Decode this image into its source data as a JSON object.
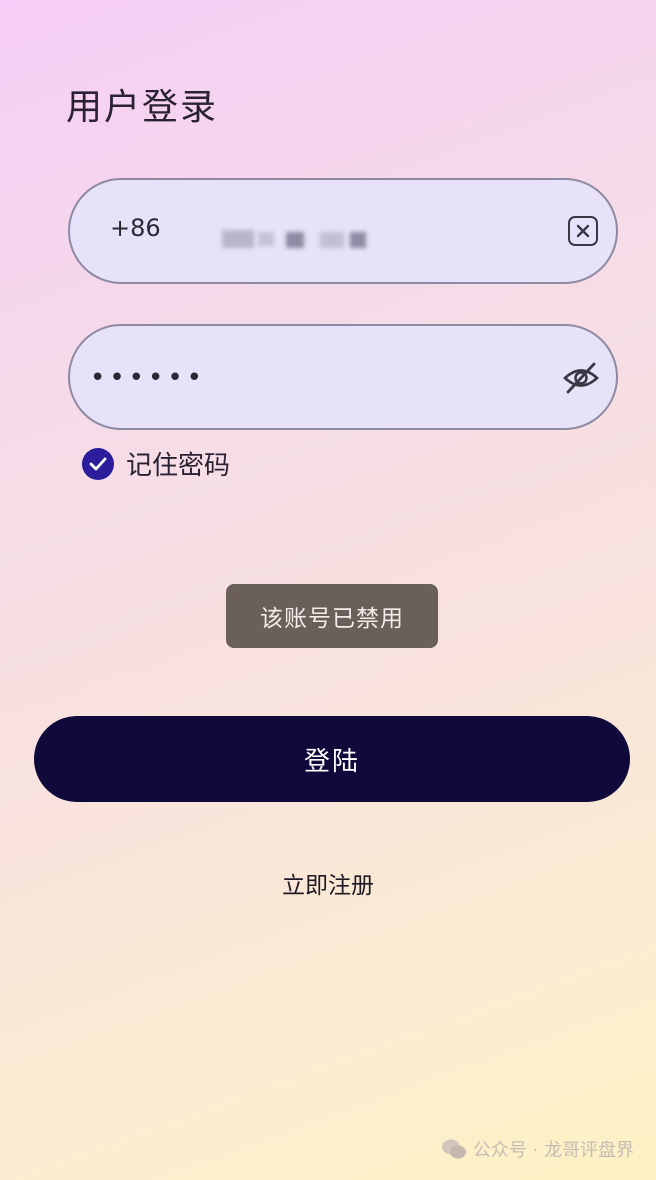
{
  "page": {
    "title": "用户登录"
  },
  "phone_field": {
    "country_code": "+86"
  },
  "password_field": {
    "value": "••••••"
  },
  "remember": {
    "label": "记住密码",
    "checked": true
  },
  "toast": {
    "message": "该账号已禁用"
  },
  "login_button": {
    "label": "登陆"
  },
  "register_link": {
    "label": "立即注册"
  },
  "watermark": {
    "text": "公众号 · 龙哥评盘界"
  },
  "colors": {
    "primary_button": "#0f0a3a",
    "checkbox": "#2b1d9c",
    "field_bg": "#e5e2fa",
    "toast_bg": "#5f5550"
  }
}
